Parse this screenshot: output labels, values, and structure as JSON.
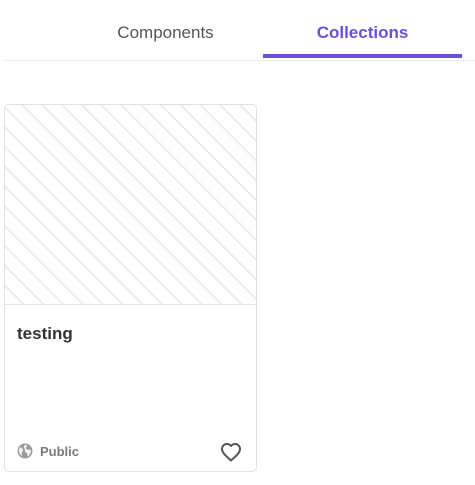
{
  "tabs": {
    "components": "Components",
    "collections": "Collections",
    "active": "collections"
  },
  "colors": {
    "accent": "#6d4fd8"
  },
  "collection_card": {
    "title": "testing",
    "visibility": "Public",
    "visibility_icon": "globe-icon",
    "favorite_icon": "heart-icon"
  }
}
